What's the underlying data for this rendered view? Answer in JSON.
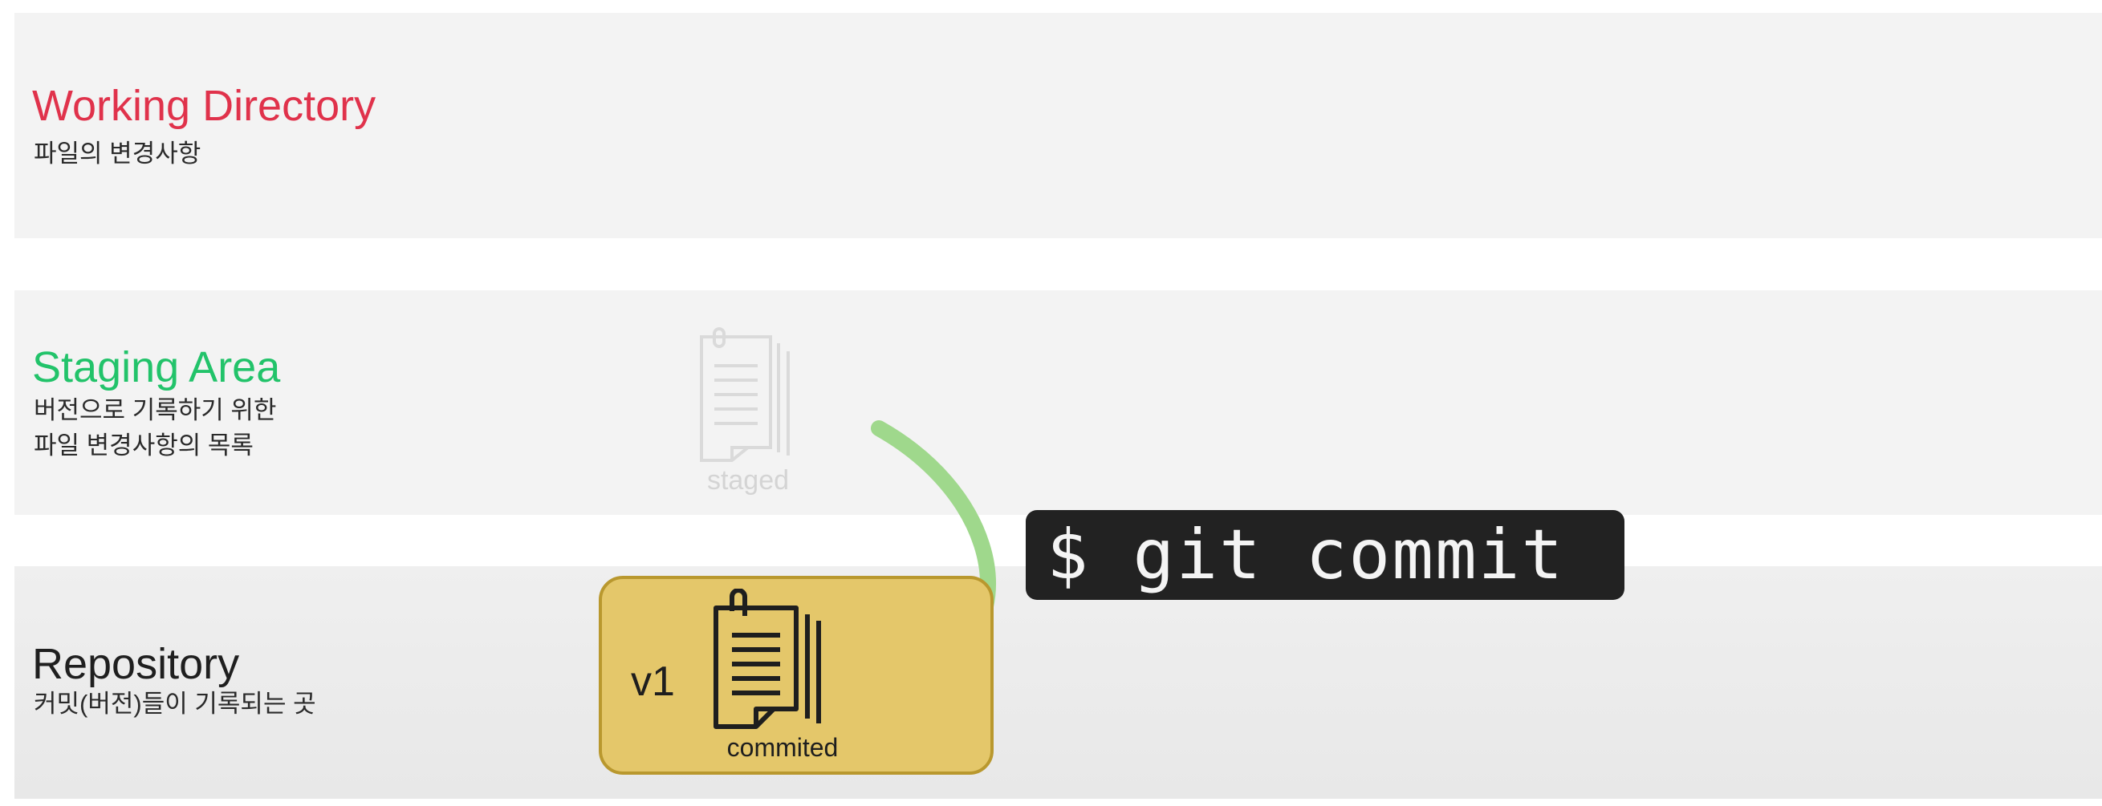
{
  "areas": {
    "working": {
      "title": "Working Directory",
      "desc_line1": "파일의 변경사항",
      "title_color": "#e0324b"
    },
    "staging": {
      "title": "Staging Area",
      "desc_line1": "버전으로 기록하기 위한",
      "desc_line2": "파일 변경사항의 목록",
      "title_color": "#22c36a"
    },
    "repository": {
      "title": "Repository",
      "desc_line1": "커밋(버전)들이 기록되는 곳",
      "title_color": "#1f1f1f"
    }
  },
  "staged_file": {
    "label": "staged",
    "icon": "document-icon"
  },
  "commit": {
    "version": "v1",
    "label": "commited",
    "icon": "document-icon",
    "box_color": "#e4c76a"
  },
  "command": {
    "text": "$ git commit"
  },
  "arrow": {
    "icon": "curved-arrow-icon",
    "color": "#9fd88c"
  }
}
